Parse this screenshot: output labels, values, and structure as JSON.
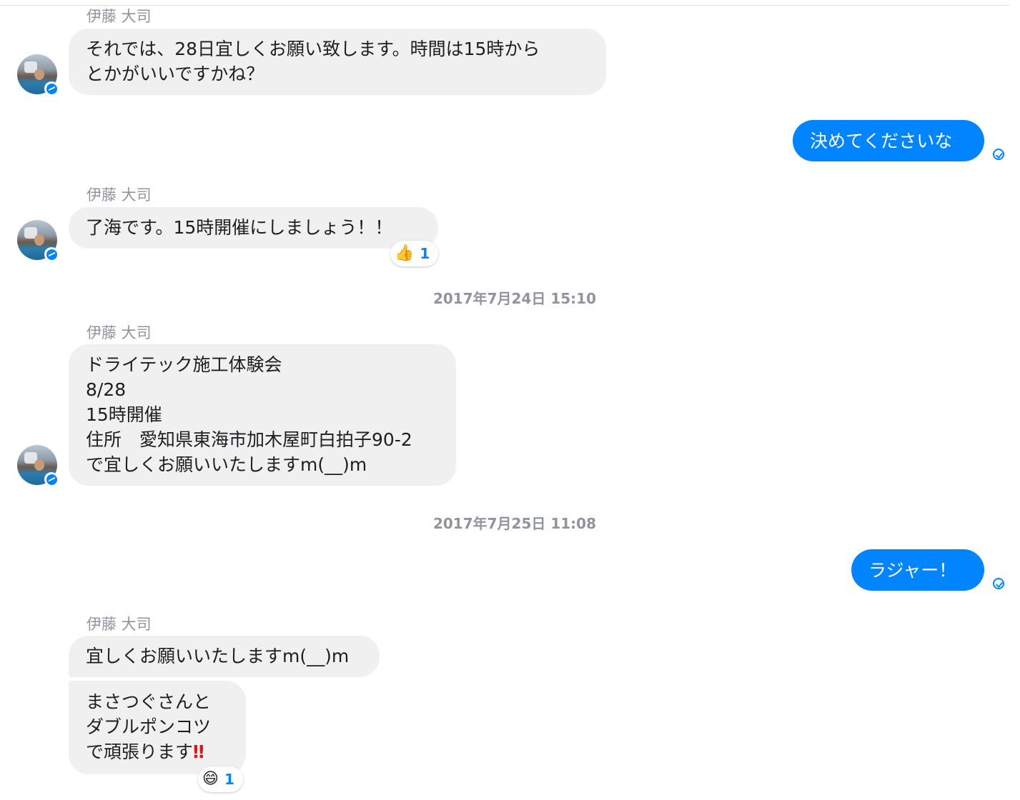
{
  "conversation": {
    "sender_name": "伊藤 大司",
    "timestamps": [
      "2017年7月24日 15:10",
      "2017年7月25日 11:08"
    ],
    "messages": [
      {
        "text": "それでは、28日宜しくお願い致します。時間は15時から\nとかがいいですかね？"
      },
      {
        "text": "決めてくださいな"
      },
      {
        "text": "了海です。15時開催にしましょう！！",
        "reaction": {
          "emoji": "👍",
          "count": "1"
        }
      },
      {
        "text": "ドライテック施工体験会\n8/28\n15時開催\n住所　愛知県東海市加木屋町白拍子90-2\nで宜しくお願いいたしますm(__)m"
      },
      {
        "text": "ラジャー！"
      },
      {
        "text": "宜しくお願いいたしますm(__)m"
      },
      {
        "text": "まさつぐさんと\nダブルポンコツ\nで頑張ります",
        "emoji": "‼",
        "reaction": {
          "emoji": "😄",
          "count": "1"
        }
      }
    ]
  },
  "colors": {
    "outgoing": "#0084ff",
    "incoming": "#f1f0f0",
    "meta": "#90949c"
  }
}
